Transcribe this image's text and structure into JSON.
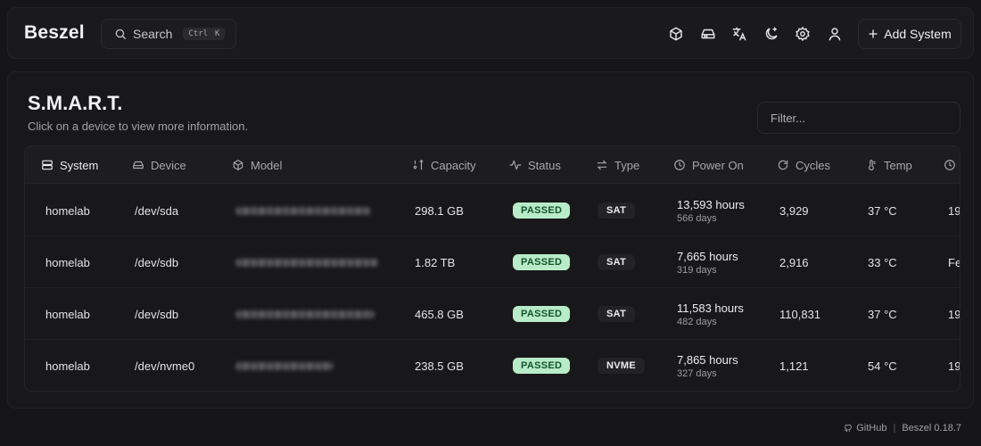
{
  "app": {
    "logo": "Beszel"
  },
  "search": {
    "label": "Search",
    "kbd_mod": "Ctrl",
    "kbd_key": "K"
  },
  "nav": {
    "icons": [
      "box-icon",
      "hard-drive-icon",
      "language-icon",
      "theme-toggle-icon",
      "settings-icon",
      "user-icon"
    ],
    "add_system": "Add System"
  },
  "page": {
    "title": "S.M.A.R.T.",
    "subtitle": "Click on a device to view more information.",
    "filter_placeholder": "Filter..."
  },
  "table": {
    "headers": {
      "system": "System",
      "device": "Device",
      "model": "Model",
      "capacity": "Capacity",
      "status": "Status",
      "type": "Type",
      "power_on": "Power On",
      "cycles": "Cycles",
      "temp": "Temp"
    },
    "rows": [
      {
        "system": "homelab",
        "device": "/dev/sda",
        "capacity": "298.1 GB",
        "status": "PASSED",
        "type": "SAT",
        "power_hours": "13,593 hours",
        "power_days": "566 days",
        "cycles": "3,929",
        "temp": "37 °C",
        "updated": "19"
      },
      {
        "system": "homelab",
        "device": "/dev/sdb",
        "capacity": "1.82 TB",
        "status": "PASSED",
        "type": "SAT",
        "power_hours": "7,665 hours",
        "power_days": "319 days",
        "cycles": "2,916",
        "temp": "33 °C",
        "updated": "Fe"
      },
      {
        "system": "homelab",
        "device": "/dev/sdb",
        "capacity": "465.8 GB",
        "status": "PASSED",
        "type": "SAT",
        "power_hours": "11,583 hours",
        "power_days": "482 days",
        "cycles": "110,831",
        "temp": "37 °C",
        "updated": "19"
      },
      {
        "system": "homelab",
        "device": "/dev/nvme0",
        "capacity": "238.5 GB",
        "status": "PASSED",
        "type": "NVME",
        "power_hours": "7,865 hours",
        "power_days": "327 days",
        "cycles": "1,121",
        "temp": "54 °C",
        "updated": "19"
      }
    ]
  },
  "footer": {
    "github": "GitHub",
    "version": "Beszel 0.18.7"
  },
  "colors": {
    "background": "#161618",
    "status_passed_bg": "#b8ecc9",
    "status_passed_text": "#14532d"
  }
}
